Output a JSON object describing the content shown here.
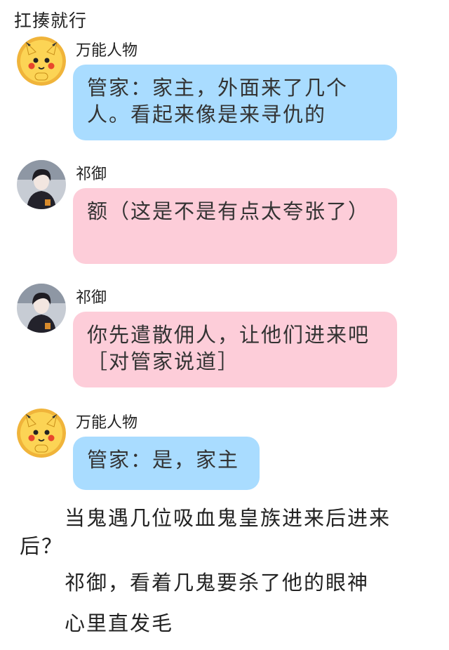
{
  "header": {
    "title": "扛揍就行"
  },
  "messages": [
    {
      "sender": "万能人物",
      "avatar": "pikachu-avatar",
      "text": "管家：家主，外面来了几个人。看起来像是来寻仇的",
      "color": "#a9dcff"
    },
    {
      "sender": "祁御",
      "avatar": "dark-haired-man-avatar",
      "text": "额（这是不是有点太夸张了）",
      "color": "#fdcdd9"
    },
    {
      "sender": "祁御",
      "avatar": "dark-haired-man-avatar",
      "text": "你先遣散佣人，让他们进来吧［对管家说道］",
      "color": "#fdcdd9"
    },
    {
      "sender": "万能人物",
      "avatar": "pikachu-avatar",
      "text": "管家：是，家主",
      "color": "#a9dcff"
    }
  ],
  "narration": [
    "当鬼遇几位吸血鬼皇族进来后进来后？",
    "祁御，看着几鬼要杀了他的眼神",
    "心里直发毛"
  ]
}
